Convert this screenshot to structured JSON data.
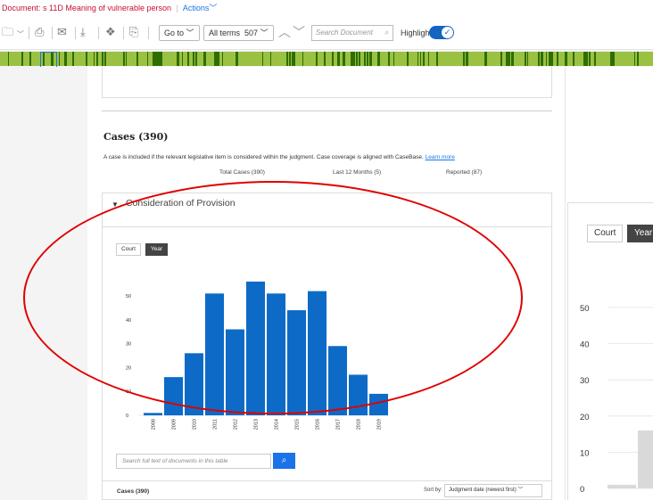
{
  "topbar": {
    "document_label": "Document:",
    "document_title": "s 11D Meaning of vulnerable person",
    "actions_label": "Actions"
  },
  "toolbar": {
    "goto_label": "Go to",
    "terms_label": "All terms",
    "terms_count": "507",
    "search_placeholder": "Search Document",
    "highlight_label": "Highlight",
    "highlight_on": true
  },
  "cases": {
    "title": "Cases (390)",
    "description": "A case is included if the relevant legislative item is considered within the judgment. Case coverage is aligned with CaseBase.",
    "learn_more": "Learn more",
    "total": "Total Cases (390)",
    "last12": "Last 12 Months (5)",
    "reported": "Reported (87)"
  },
  "panel": {
    "title": "Consideration of Provision",
    "court_label": "Court",
    "year_label": "Year",
    "search_placeholder": "Search full text of documents in this table",
    "table_label": "Cases (390)",
    "sort_label": "Sort by:",
    "sort_value": "Judgment date (newest first)"
  },
  "right_panel": {
    "court_label": "Court",
    "year_label": "Year"
  },
  "chart_data": {
    "type": "bar",
    "categories": [
      "2008",
      "2009",
      "2010",
      "2011",
      "2012",
      "2013",
      "2014",
      "2015",
      "2016",
      "2017",
      "2018",
      "2019"
    ],
    "values": [
      1,
      16,
      26,
      51,
      36,
      56,
      51,
      44,
      52,
      29,
      17,
      9
    ],
    "yticks": [
      "0",
      "10",
      "20",
      "30",
      "40",
      "50"
    ],
    "ylim": [
      0,
      60
    ],
    "bar_color": "#0d6bc7"
  },
  "right_chart": {
    "yticks": [
      "0",
      "10",
      "20",
      "30",
      "40",
      "50"
    ],
    "visible_values": [
      1,
      16
    ]
  },
  "colors": {
    "accent": "#1a73e8",
    "annotation": "#e00000",
    "hitbar": "#9bc143"
  }
}
